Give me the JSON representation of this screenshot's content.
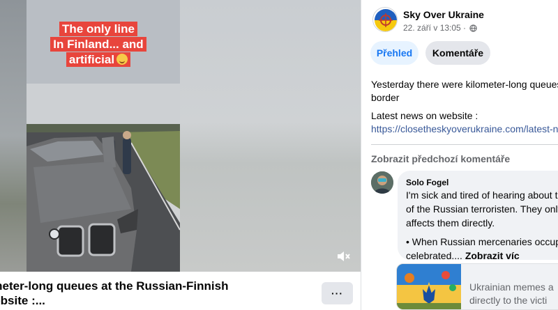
{
  "video": {
    "caption_lines": [
      "The only line",
      "In Finland... and",
      "artificial"
    ],
    "caption_emoji": "smiling-face-with-heart-eyes",
    "title": "ometer-long queues at the Russian-Finnish website :...",
    "title_line1": "ometer-long queues at the Russian-Finnish",
    "title_line2": "website :...",
    "more_label": "···"
  },
  "post": {
    "page_name": "Sky Over Ukraine",
    "timestamp": "22. září v 13:05 · ",
    "tabs": [
      {
        "label": "Přehled",
        "active": true
      },
      {
        "label": "Komentáře",
        "active": false
      }
    ],
    "text_line1": "Yesterday there were kilometer-long queues",
    "text_line2": "border",
    "news_label": "Latest news on website :",
    "news_link": "https://closetheskyoverukraine.com/latest-n"
  },
  "comments": {
    "show_previous_label": "Zobrazit předchozí komentáře",
    "items": [
      {
        "author": "Solo Fogel",
        "lines": [
          "I'm sick and tired of hearing about t",
          "of the Russian terroristen. They only",
          "affects them directly.",
          "",
          "• When Russian mercenaries occupie",
          "celebrated.... "
        ],
        "see_more": "Zobrazit víc"
      }
    ]
  },
  "link_card": {
    "line1": "Ukrainian memes a",
    "line2": "directly to the victi"
  },
  "colors": {
    "caption_bg": "#e8453c",
    "link": "#385898",
    "tab_active_bg": "#e7f3ff",
    "tab_active_text": "#1877f2",
    "button_bg": "#e4e6eb"
  }
}
